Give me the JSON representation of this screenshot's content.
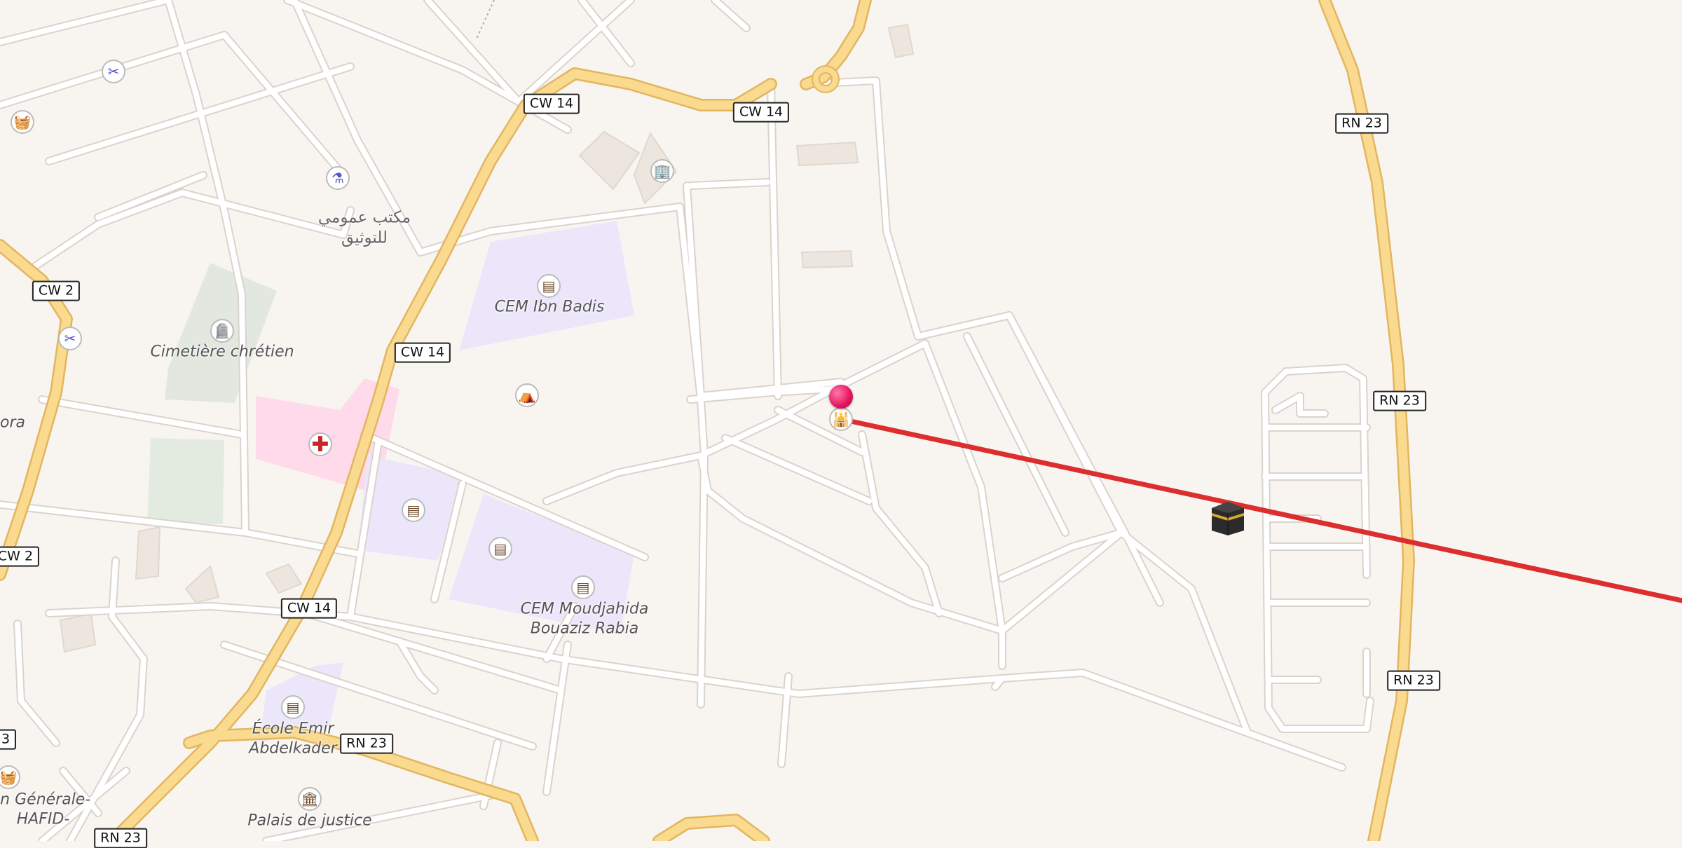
{
  "map": {
    "colors": {
      "background": "#f8f5f1",
      "minor_road": "#ffffff",
      "major_road": "#f7d27a",
      "qibla_line": "#dc2e2e",
      "school_area": "#ece6fb",
      "hospital_area": "#ffdaea",
      "cemetery_area": "#e2e8e0"
    },
    "road_labels": [
      "CW 14",
      "CW 14",
      "CW 14",
      "CW 14",
      "CW 2",
      "CW 2",
      "RN 23",
      "RN 23",
      "RN 23",
      "RN 23",
      "RN 23",
      "3"
    ],
    "place_labels": [
      "مكتب عمومي\nللتوثيق",
      "CEM Ibn Badis",
      "Cimetière chrétien",
      "CEM Moudjahida\nBouaziz Rabia",
      "École Emir\nAbdelkader",
      "Palais de justice",
      "ora",
      "on Générale-\n HAFID-"
    ],
    "pois": [
      {
        "name": "scissors-icon",
        "glyph": "✂",
        "kind": "shop"
      },
      {
        "name": "shopping-basket-icon",
        "glyph": "🧺",
        "kind": "shop"
      },
      {
        "name": "pharmacy-icon",
        "glyph": "⚗",
        "kind": "shop"
      },
      {
        "name": "scissors-icon",
        "glyph": "✂",
        "kind": "shop"
      },
      {
        "name": "school-icon",
        "glyph": "▤",
        "kind": "school"
      },
      {
        "name": "cemetery-icon",
        "glyph": "🪦",
        "kind": "cemetery"
      },
      {
        "name": "theatre-icon",
        "glyph": "⛺",
        "kind": "shop"
      },
      {
        "name": "hospital-icon",
        "glyph": "✚",
        "kind": "hospital"
      },
      {
        "name": "school-icon",
        "glyph": "▤",
        "kind": "school"
      },
      {
        "name": "school-icon",
        "glyph": "▤",
        "kind": "school"
      },
      {
        "name": "school-icon",
        "glyph": "▤",
        "kind": "school"
      },
      {
        "name": "school-icon",
        "glyph": "▤",
        "kind": "school"
      },
      {
        "name": "courthouse-icon",
        "glyph": "🏛",
        "kind": "cemetery"
      },
      {
        "name": "shopping-basket-icon",
        "glyph": "🧺",
        "kind": "shop"
      },
      {
        "name": "townhall-icon",
        "glyph": "🏢",
        "kind": "cemetery"
      },
      {
        "name": "mosque-icon",
        "glyph": "🕌",
        "kind": "mosque"
      }
    ],
    "qibla_marker_icon": "kaaba-icon",
    "location_pin_icon": "location-pin-icon"
  }
}
